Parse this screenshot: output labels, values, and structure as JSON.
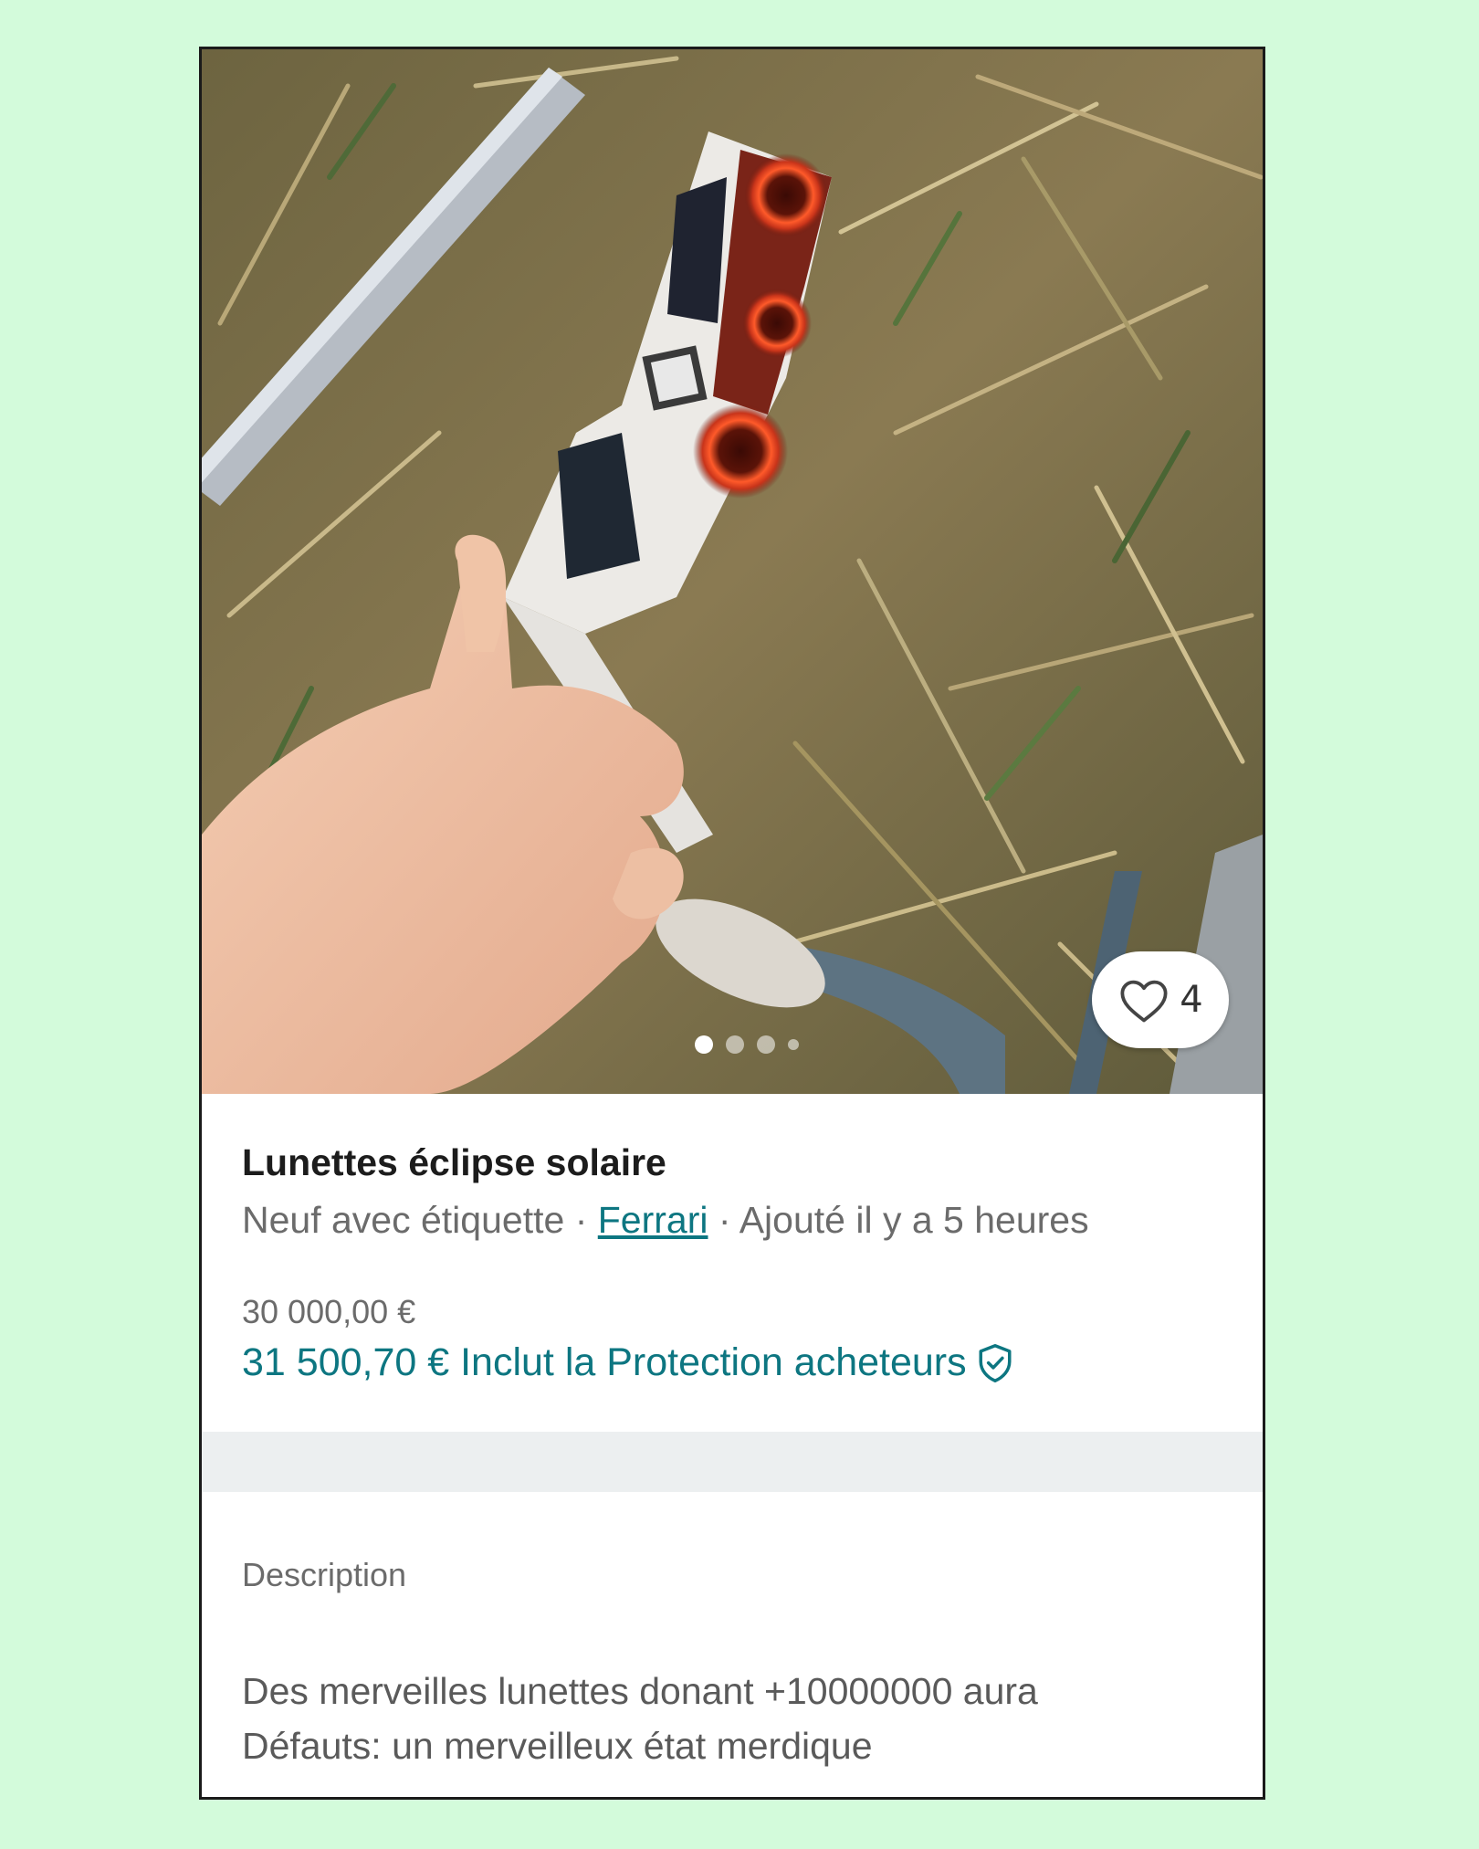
{
  "listing": {
    "title": "Lunettes éclipse solaire",
    "condition": "Neuf avec étiquette",
    "separator": "·",
    "brand": "Ferrari",
    "added": "Ajouté il y a 5 heures",
    "price": "30 000,00 €",
    "price_with_protection": "31 500,70 € Inclut la Protection acheteurs",
    "likes": "4",
    "photo_count": 4,
    "active_photo": 1
  },
  "description": {
    "label": "Description",
    "line1": "Des merveilles lunettes donant +10000000 aura",
    "line2": "Défauts: un merveilleux état merdique"
  },
  "colors": {
    "background": "#d3fbdb",
    "accent": "#0d7681",
    "divider": "#eceff0"
  },
  "icons": {
    "like": "heart-icon",
    "protection": "shield-check-icon"
  }
}
